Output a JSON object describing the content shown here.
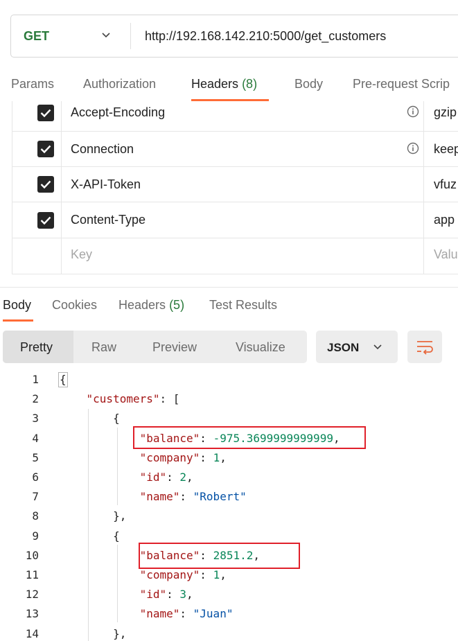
{
  "request": {
    "method": "GET",
    "url": "http://192.168.142.210:5000/get_customers"
  },
  "tabs": [
    {
      "label": "Params",
      "count": ""
    },
    {
      "label": "Authorization",
      "count": ""
    },
    {
      "label": "Headers",
      "count": "(8)"
    },
    {
      "label": "Body",
      "count": ""
    },
    {
      "label": "Pre-request Scrip",
      "count": ""
    }
  ],
  "headers": [
    {
      "checked": true,
      "key": "Accept-Encoding",
      "value": "gzip",
      "info": true
    },
    {
      "checked": true,
      "key": "Connection",
      "value": "keep",
      "info": true
    },
    {
      "checked": true,
      "key": "X-API-Token",
      "value": "vfuz",
      "info": false
    },
    {
      "checked": true,
      "key": "Content-Type",
      "value": "app",
      "info": false
    }
  ],
  "headers_placeholder": {
    "key": "Key",
    "value": "Valu"
  },
  "response_tabs": [
    {
      "label": "Body",
      "count": ""
    },
    {
      "label": "Cookies",
      "count": ""
    },
    {
      "label": "Headers",
      "count": "(5)"
    },
    {
      "label": "Test Results",
      "count": ""
    }
  ],
  "views": [
    "Pretty",
    "Raw",
    "Preview",
    "Visualize"
  ],
  "format": "JSON",
  "code_lines": [
    {
      "n": "1",
      "t": "{"
    },
    {
      "n": "2",
      "t": "    \"customers\": ["
    },
    {
      "n": "3",
      "t": "        {"
    },
    {
      "n": "4",
      "t": "            \"balance\": -975.3699999999999,"
    },
    {
      "n": "5",
      "t": "            \"company\": 1,"
    },
    {
      "n": "6",
      "t": "            \"id\": 2,"
    },
    {
      "n": "7",
      "t": "            \"name\": \"Robert\""
    },
    {
      "n": "8",
      "t": "        },"
    },
    {
      "n": "9",
      "t": "        {"
    },
    {
      "n": "10",
      "t": "            \"balance\": 2851.2,"
    },
    {
      "n": "11",
      "t": "            \"company\": 1,"
    },
    {
      "n": "12",
      "t": "            \"id\": 3,"
    },
    {
      "n": "13",
      "t": "            \"name\": \"Juan\""
    },
    {
      "n": "14",
      "t": "        },"
    }
  ],
  "colors": {
    "accent": "#ff6c37",
    "method": "#2a7a3b",
    "highlight": "#e0202a"
  }
}
